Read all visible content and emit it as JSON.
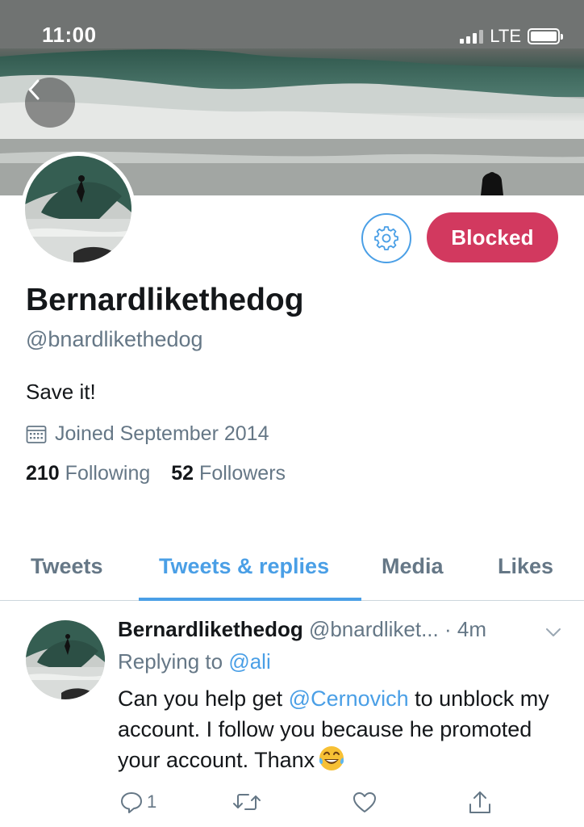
{
  "status_bar": {
    "time": "11:00",
    "network": "LTE"
  },
  "profile": {
    "display_name": "Bernardlikethedog",
    "handle": "@bnardlikethedog",
    "bio": "Save it!",
    "joined": "Joined September 2014",
    "following_count": "210",
    "following_label": "Following",
    "followers_count": "52",
    "followers_label": "Followers",
    "blocked_label": "Blocked"
  },
  "tabs": [
    {
      "label": "Tweets"
    },
    {
      "label": "Tweets & replies"
    },
    {
      "label": "Media"
    },
    {
      "label": "Likes"
    }
  ],
  "tweet": {
    "name": "Bernardlikethedog",
    "handle": "@bnardliket...",
    "time": "· 4m",
    "replying_prefix": "Replying to",
    "replying_mention": "@ali",
    "text_part1": "Can you help get ",
    "text_mention": "@Cernovich",
    "text_part2": " to unblock my account. I follow you because he promoted your account. Thanx",
    "reply_count": "1"
  },
  "colors": {
    "accent": "#4a9fe6",
    "blocked": "#d2395f",
    "secondary_text": "#657786"
  },
  "icons": {
    "back": "chevron-left-icon",
    "settings": "gear-icon",
    "calendar": "calendar-icon",
    "reply": "reply-icon",
    "retweet": "retweet-icon",
    "like": "heart-icon",
    "share": "share-icon",
    "emoji": "tears-of-joy-emoji"
  }
}
